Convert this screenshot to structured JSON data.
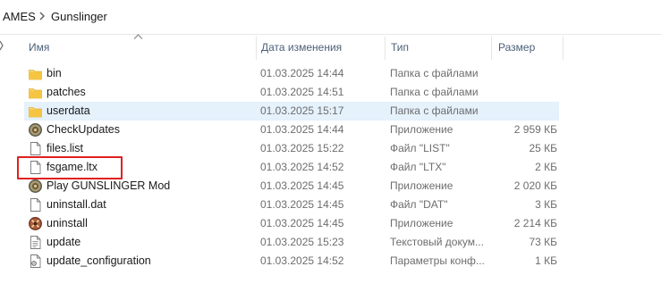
{
  "breadcrumb": {
    "parent": "AMES",
    "current": "Gunslinger"
  },
  "columns": {
    "name": "Имя",
    "date": "Дата изменения",
    "type": "Тип",
    "size": "Размер"
  },
  "files": [
    {
      "name": "bin",
      "date": "01.03.2025 14:44",
      "type": "Папка с файлами",
      "size": "",
      "icon": "folder-icon"
    },
    {
      "name": "patches",
      "date": "01.03.2025 14:51",
      "type": "Папка с файлами",
      "size": "",
      "icon": "folder-icon"
    },
    {
      "name": "userdata",
      "date": "01.03.2025 15:17",
      "type": "Папка с файлами",
      "size": "",
      "icon": "folder-icon"
    },
    {
      "name": "CheckUpdates",
      "date": "01.03.2025 14:44",
      "type": "Приложение",
      "size": "2 959 КБ",
      "icon": "app-gear-icon"
    },
    {
      "name": "files.list",
      "date": "01.03.2025 15:22",
      "type": "Файл \"LIST\"",
      "size": "25 КБ",
      "icon": "file-icon"
    },
    {
      "name": "fsgame.ltx",
      "date": "01.03.2025 14:52",
      "type": "Файл \"LTX\"",
      "size": "2 КБ",
      "icon": "file-icon"
    },
    {
      "name": "Play GUNSLINGER Mod",
      "date": "01.03.2025 14:45",
      "type": "Приложение",
      "size": "2 020 КБ",
      "icon": "app-gear-icon"
    },
    {
      "name": "uninstall.dat",
      "date": "01.03.2025 14:45",
      "type": "Файл \"DAT\"",
      "size": "3 КБ",
      "icon": "file-icon"
    },
    {
      "name": "uninstall",
      "date": "01.03.2025 14:45",
      "type": "Приложение",
      "size": "2 214 КБ",
      "icon": "uninstall-app-icon"
    },
    {
      "name": "update",
      "date": "01.03.2025 15:23",
      "type": "Текстовый докум...",
      "size": "73 КБ",
      "icon": "text-document-icon"
    },
    {
      "name": "update_configuration",
      "date": "01.03.2025 14:52",
      "type": "Параметры конф...",
      "size": "1 КБ",
      "icon": "config-file-icon"
    }
  ],
  "selected_file": "userdata",
  "highlighted_file": "fsgame.ltx",
  "colors": {
    "selection": "#e5f1fb",
    "highlight_border": "#e02020",
    "folder": "#f5c542",
    "header_text": "#4c607a"
  }
}
